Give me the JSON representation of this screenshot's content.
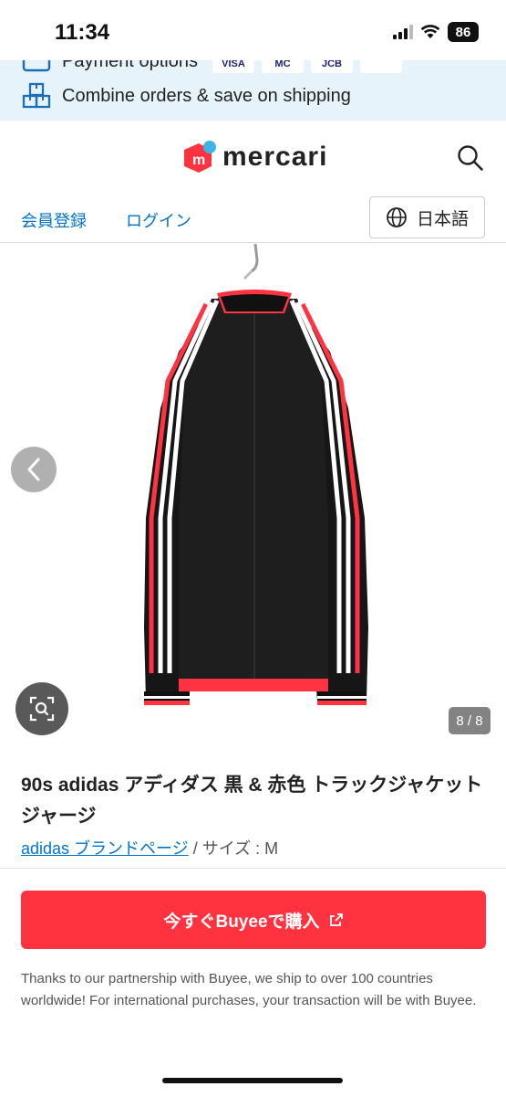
{
  "status_bar": {
    "time": "11:34",
    "battery": "86"
  },
  "banner": {
    "partial_text": "Payment options",
    "pay_logos": [
      "VISA",
      "MC",
      "JCB",
      ""
    ],
    "combine_text": "Combine orders & save on shipping"
  },
  "header": {
    "logo_text": "mercari"
  },
  "nav": {
    "register": "会員登録",
    "login": "ログイン",
    "language": "日本語"
  },
  "gallery": {
    "counter": "8 / 8"
  },
  "product": {
    "title": "90s adidas アディダス 黒 & 赤色 トラックジャケット ジャージ",
    "brand_link": "adidas ブランドページ",
    "size_text": " / サイズ : M"
  },
  "buy_button": {
    "label": "今すぐBuyeeで購入"
  },
  "note": "Thanks to our partnership with Buyee, we ship to over 100 countries worldwide! For international purchases, your transaction will be with Buyee.",
  "colors": {
    "accent_red": "#ff333f",
    "link_blue": "#0073cc",
    "banner_bg": "#e6f3fa"
  }
}
